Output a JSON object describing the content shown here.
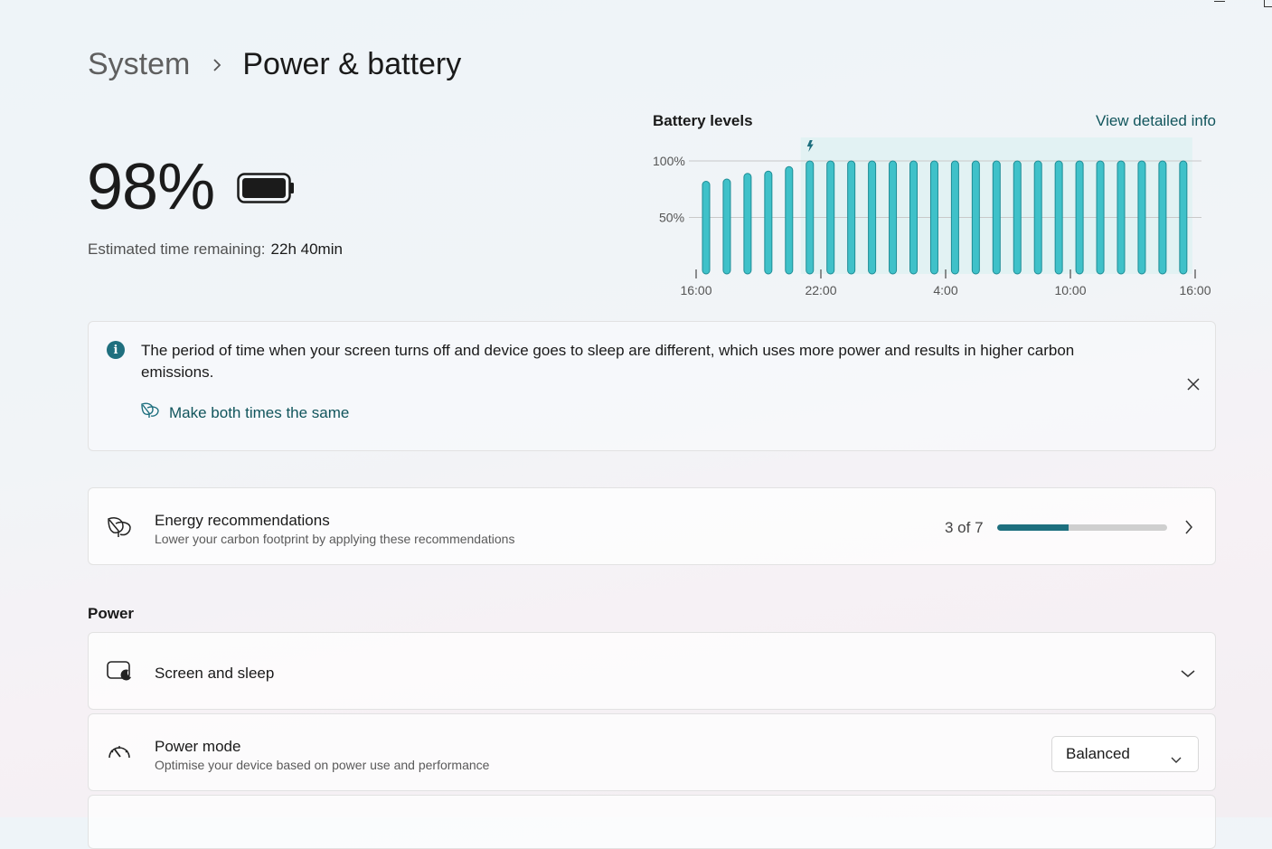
{
  "breadcrumb": {
    "root": "System",
    "current": "Power & battery"
  },
  "battery": {
    "percent": "98%",
    "estimate_label": "Estimated time remaining:",
    "estimate_value": "22h 40min"
  },
  "chart_data": {
    "type": "bar",
    "title": "Battery levels",
    "link": "View detailed info",
    "y_ticks": [
      "100%",
      "50%"
    ],
    "x_ticks": [
      "16:00",
      "22:00",
      "4:00",
      "10:00",
      "16:00"
    ],
    "ylim": [
      0,
      100
    ],
    "values": [
      82,
      84,
      89,
      91,
      95,
      100,
      100,
      100,
      100,
      100,
      100,
      100,
      100,
      100,
      100,
      100,
      100,
      100,
      100,
      100,
      100,
      100,
      100,
      100
    ],
    "charging_marker": "charging-bolt-icon",
    "bar_color": "#3fc1c9",
    "grid": true
  },
  "info": {
    "message": "The period of time when your screen turns off and device goes to sleep are different, which uses more power and results in higher carbon emissions.",
    "action": "Make both times the same"
  },
  "energy": {
    "title": "Energy recommendations",
    "subtitle": "Lower your carbon footprint by applying these recommendations",
    "progress_text": "3 of 7",
    "progress_fraction": 0.42
  },
  "power_section": {
    "heading": "Power",
    "screen_sleep": {
      "title": "Screen and sleep"
    },
    "power_mode": {
      "title": "Power mode",
      "subtitle": "Optimise your device based on power use and performance",
      "selected": "Balanced"
    }
  },
  "colors": {
    "accent": "#1d6f7e",
    "link": "#11555c",
    "bar": "#3fc1c9"
  }
}
